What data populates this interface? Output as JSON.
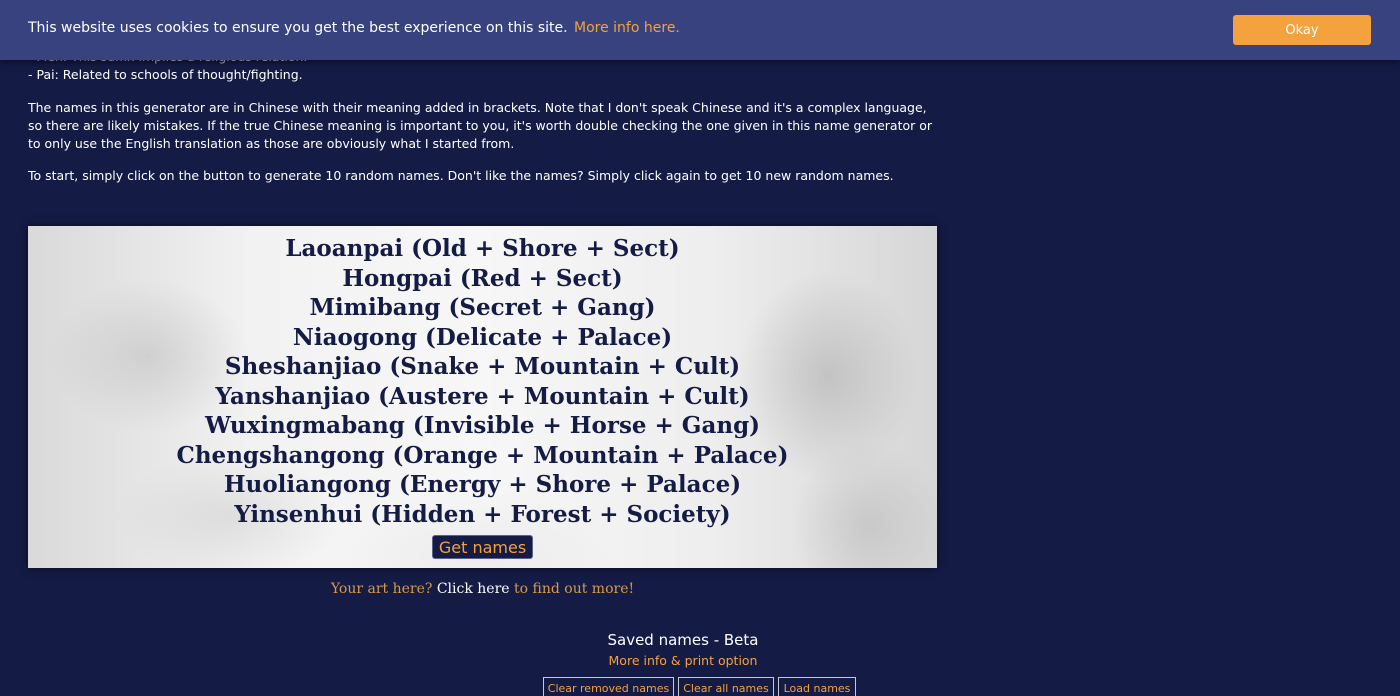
{
  "cookie_banner": {
    "text": "This website uses cookies to ensure you get the best experience on this site.",
    "link": "More info here.",
    "button": "Okay"
  },
  "intro": {
    "line_men": "- Men: This suffix implies a religious relation.",
    "line_pai": "- Pai: Related to schools of thought/fighting.",
    "para_names": "The names in this generator are in Chinese with their meaning added in brackets. Note that I don't speak Chinese and it's a complex language, so there are likely mistakes. If the true Chinese meaning is important to you, it's worth double checking the one given in this name generator or to only use the English translation as those are obviously what I started from.",
    "para_start": "To start, simply click on the button to generate 10 random names. Don't like the names? Simply click again to get 10 new random names."
  },
  "generator": {
    "names": [
      "Laoanpai (Old + Shore + Sect)",
      "Hongpai (Red + Sect)",
      "Mimibang (Secret + Gang)",
      "Niaogong (Delicate + Palace)",
      "Sheshanjiao (Snake + Mountain + Cult)",
      "Yanshanjiao (Austere + Mountain + Cult)",
      "Wuxingmabang (Invisible + Horse + Gang)",
      "Chengshangong (Orange + Mountain + Palace)",
      "Huoliangong (Energy + Shore + Palace)",
      "Yinsenhui (Hidden + Forest + Society)"
    ],
    "button": "Get names"
  },
  "art": {
    "prefix": "Your art here?",
    "link": "Click here",
    "suffix": "to find out more!"
  },
  "saved": {
    "title": "Saved names - Beta",
    "more": "More info & print option",
    "buttons": {
      "clear_removed": "Clear removed names",
      "clear_all": "Clear all names",
      "load": "Load names"
    }
  },
  "colors": {
    "background": "#141b45",
    "banner": "#38427f",
    "accent": "#f4a23d"
  }
}
